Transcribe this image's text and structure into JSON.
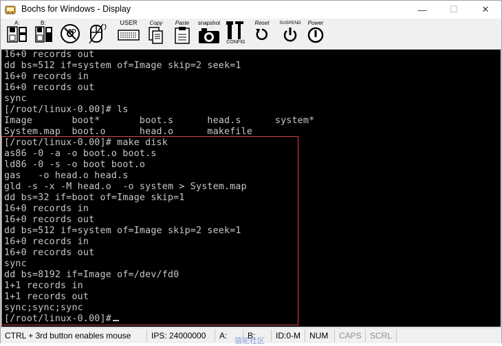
{
  "window": {
    "title": "Bochs for Windows - Display"
  },
  "titlebar_buttons": {
    "minimize": "—",
    "maximize": "☐",
    "close": "✕"
  },
  "toolbar": {
    "a_label": "A:",
    "b_label": "B:",
    "cd_label": "CD",
    "user_label": "USER",
    "copy_label": "Copy",
    "paste_label": "Paste",
    "snapshot_label": "snapshot",
    "config_label": "CONFIG",
    "reset_label": "Reset",
    "suspend_label": "SUSPEND",
    "power_label": "Power"
  },
  "terminal": {
    "lines": [
      "16+0 records out",
      "dd bs=512 if=system of=Image skip=2 seek=1",
      "16+0 records in",
      "16+0 records out",
      "sync",
      "[/root/linux-0.00]# ls",
      "Image       boot*       boot.s      head.s      system*",
      "System.map  boot.o      head.o      makefile",
      "[/root/linux-0.00]# make disk",
      "as86 -0 -a -o boot.o boot.s",
      "ld86 -0 -s -o boot boot.o",
      "gas   -o head.o head.s",
      "gld -s -x -M head.o  -o system > System.map",
      "dd bs=32 if=boot of=Image skip=1",
      "16+0 records in",
      "16+0 records out",
      "dd bs=512 if=system of=Image skip=2 seek=1",
      "16+0 records in",
      "16+0 records out",
      "sync",
      "dd bs=8192 if=Image of=/dev/fd0",
      "1+1 records in",
      "1+1 records out",
      "sync;sync;sync",
      "[/root/linux-0.00]#"
    ]
  },
  "statusbar": {
    "hint": "CTRL + 3rd button enables mouse",
    "ips": "IPS: 24000000",
    "a": "A:",
    "b": "B:",
    "id": "ID:0-M",
    "num": "NUM",
    "caps": "CAPS",
    "scrl": "SCRL"
  },
  "watermark": "骆驼社区"
}
